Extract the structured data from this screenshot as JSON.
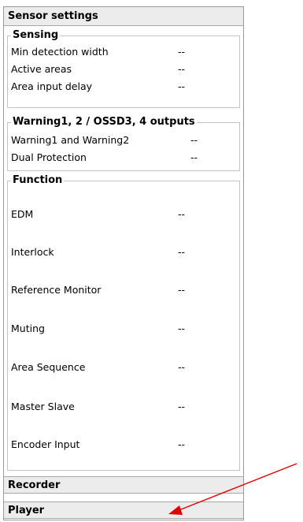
{
  "panel": {
    "title": "Sensor settings"
  },
  "sensing": {
    "label": "Sensing",
    "rows": [
      {
        "label": "Min detection width",
        "value": "--"
      },
      {
        "label": "Active areas",
        "value": "--"
      },
      {
        "label": "Area input delay",
        "value": "--"
      }
    ]
  },
  "warning": {
    "label": "Warning1, 2 / OSSD3, 4 outputs",
    "rows": [
      {
        "label": "Warning1 and Warning2",
        "value": "--"
      },
      {
        "label": "Dual Protection",
        "value": "--"
      }
    ]
  },
  "function": {
    "label": "Function",
    "rows": [
      {
        "label": "EDM",
        "value": "--"
      },
      {
        "label": "Interlock",
        "value": "--"
      },
      {
        "label": "Reference Monitor",
        "value": "--"
      },
      {
        "label": "Muting",
        "value": "--"
      },
      {
        "label": "Area Sequence",
        "value": "--"
      },
      {
        "label": "Master Slave",
        "value": "--"
      },
      {
        "label": "Encoder Input",
        "value": "--"
      }
    ]
  },
  "recorder": {
    "label": "Recorder"
  },
  "player": {
    "label": "Player"
  },
  "colors": {
    "annotation_arrow": "#e00000",
    "bar_background": "#ececec"
  }
}
